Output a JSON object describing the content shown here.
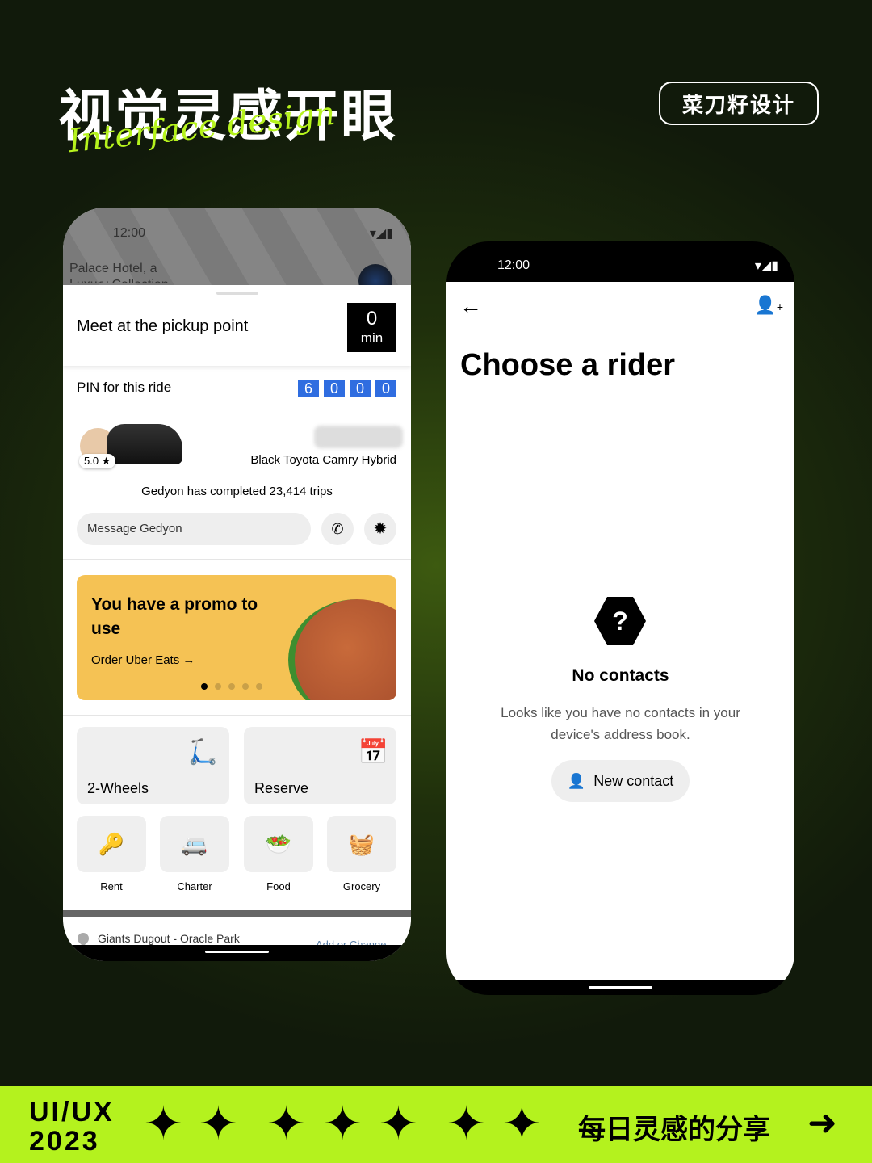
{
  "header": {
    "title": "视觉灵感开眼",
    "script": "Interface design",
    "brand": "菜刀籽设计"
  },
  "left_phone": {
    "time": "12:00",
    "map_label": "Palace Hotel, a Luxury Collection",
    "pickup": "Meet at the pickup point",
    "eta_value": "0",
    "eta_unit": "min",
    "pin_label": "PIN for this ride",
    "pin": [
      "6",
      "0",
      "0",
      "0"
    ],
    "rating": "5.0 ★",
    "car": "Black Toyota Camry Hybrid",
    "trips": "Gedyon has completed 23,414 trips",
    "message_placeholder": "Message Gedyon",
    "promo": {
      "title": "You have a promo to use",
      "link": "Order Uber Eats →",
      "dots": 5,
      "active_dot": 0
    },
    "services": [
      {
        "label": "2-Wheels"
      },
      {
        "label": "Reserve"
      }
    ],
    "small_services": [
      {
        "label": "Rent"
      },
      {
        "label": "Charter"
      },
      {
        "label": "Food"
      },
      {
        "label": "Grocery"
      }
    ],
    "destination": "Giants Dugout - Oracle Park",
    "destination_action": "Add or Change"
  },
  "right_phone": {
    "time": "12:00",
    "title": "Choose a rider",
    "empty_title": "No contacts",
    "empty_text": "Looks like you have no contacts in your device's address book.",
    "new_contact": "New contact"
  },
  "footer": {
    "tag_line1": "UI/UX",
    "tag_line2": "2023",
    "slogan": "每日灵感的分享",
    "accent": "#b4f21e"
  }
}
